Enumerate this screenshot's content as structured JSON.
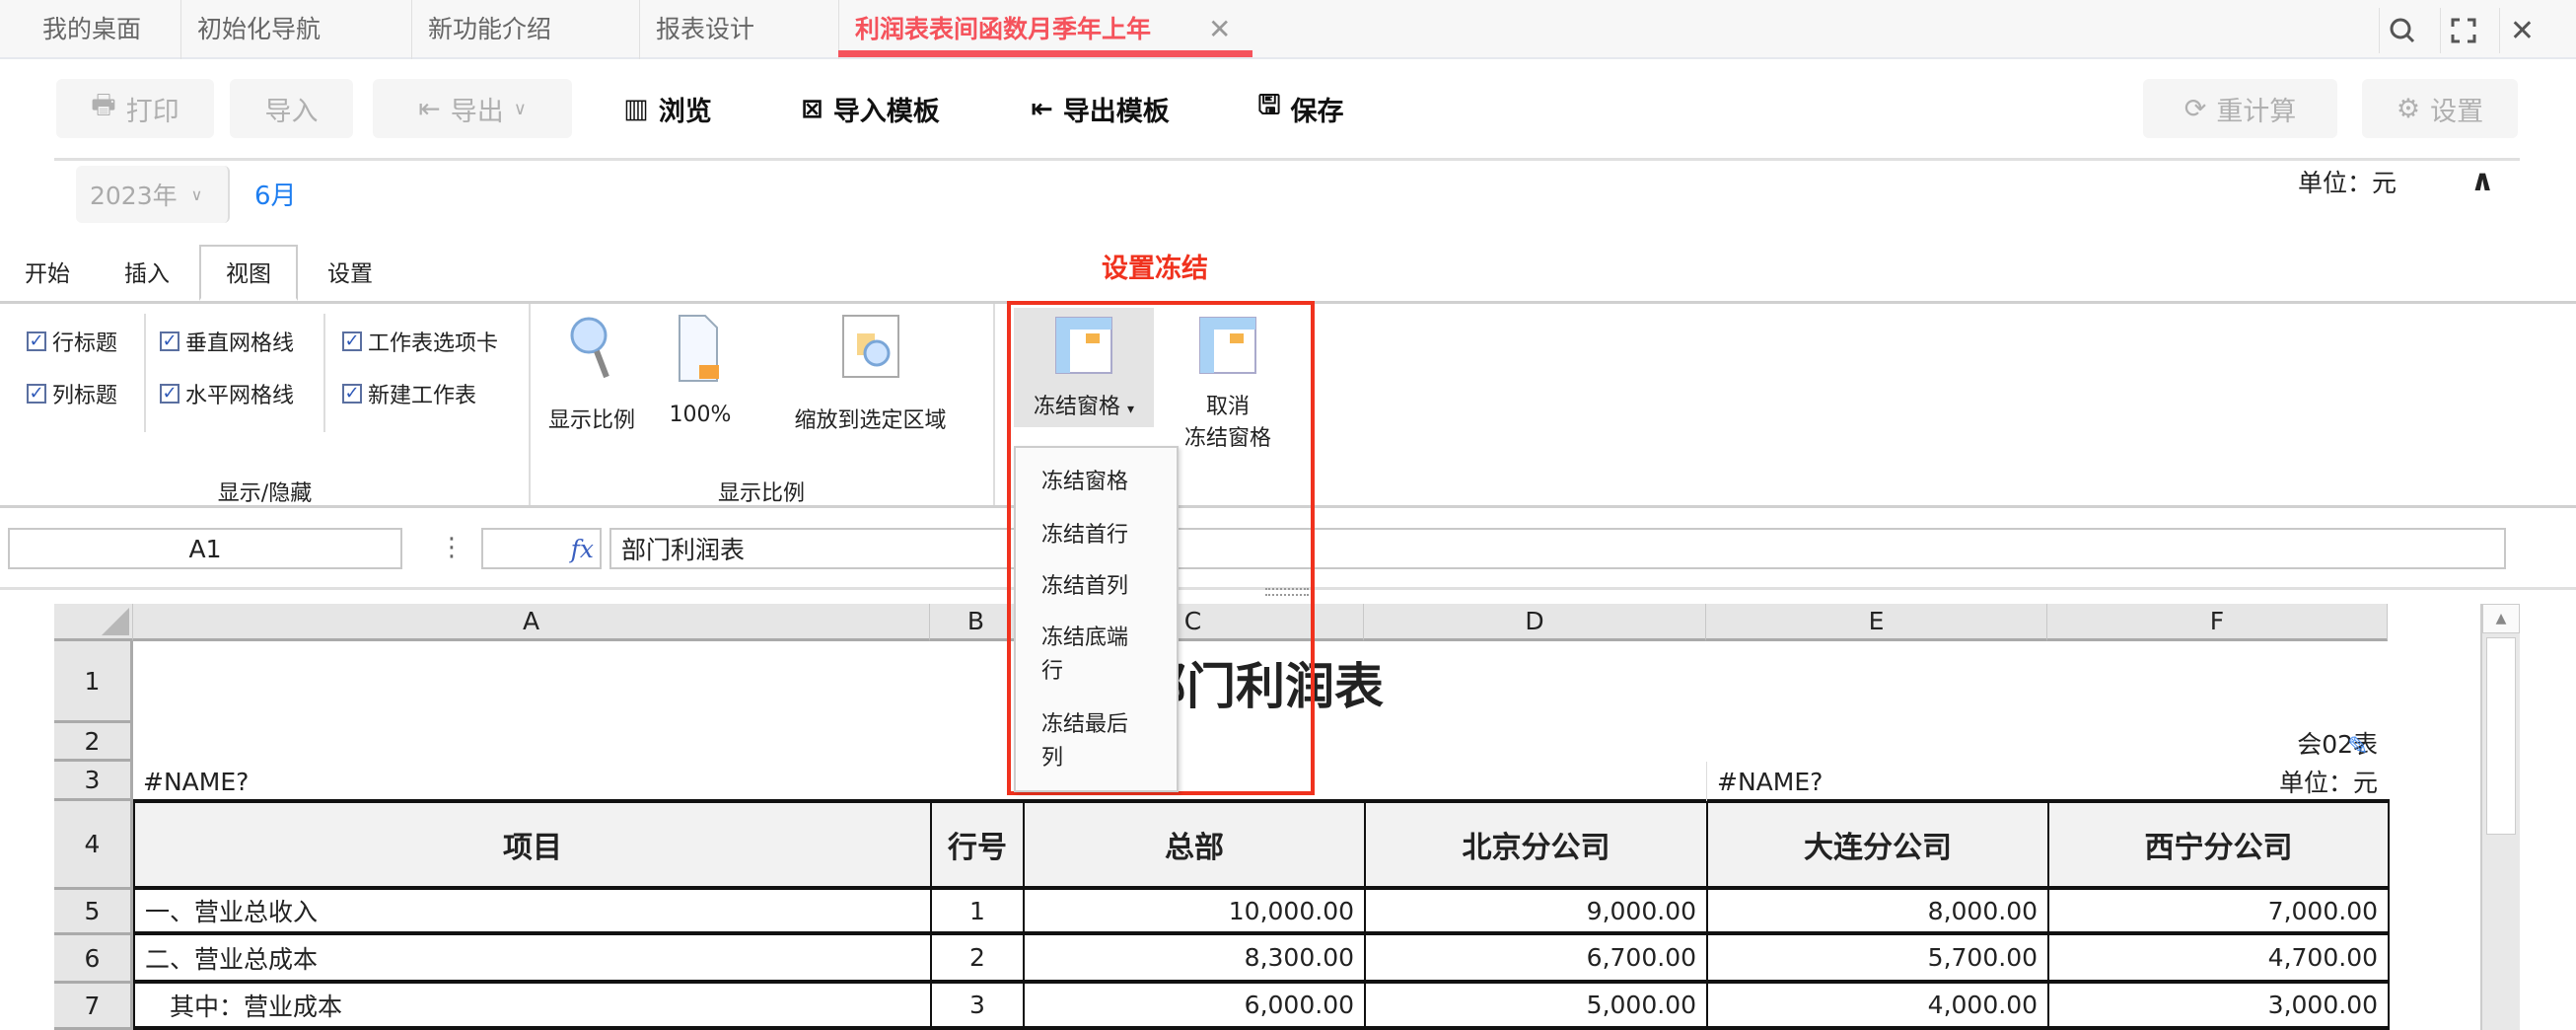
{
  "tabs": [
    {
      "label": "我的桌面"
    },
    {
      "label": "初始化导航"
    },
    {
      "label": "新功能介绍"
    },
    {
      "label": "报表设计"
    },
    {
      "label": "利润表表间函数月季年上年",
      "active": true
    }
  ],
  "window_icons": [
    "search-icon",
    "fullscreen-icon",
    "close-icon"
  ],
  "toolbar": {
    "print": "打印",
    "import": "导入",
    "export": "导出",
    "browse": "浏览",
    "import_template": "导入模板",
    "export_template": "导出模板",
    "save": "保存",
    "recalc": "重计算",
    "settings": "设置"
  },
  "filter": {
    "year": "2023年",
    "month": "6月",
    "unit": "单位：元"
  },
  "ribbon_tabs": [
    {
      "label": "开始"
    },
    {
      "label": "插入"
    },
    {
      "label": "视图",
      "active": true
    },
    {
      "label": "设置"
    }
  ],
  "annotation": "设置冻结",
  "show_hide": {
    "checks": [
      {
        "label": "行标题",
        "checked": true
      },
      {
        "label": "列标题",
        "checked": true
      },
      {
        "label": "垂直网格线",
        "checked": true
      },
      {
        "label": "水平网格线",
        "checked": true
      },
      {
        "label": "工作表选项卡",
        "checked": true
      },
      {
        "label": "新建工作表",
        "checked": true
      }
    ],
    "group_label": "显示/隐藏"
  },
  "zoom_group": {
    "zoom": "显示比例",
    "hundred": "100%",
    "fit": "缩放到选定区域",
    "group_label": "显示比例"
  },
  "freeze": {
    "freeze_panes": "冻结窗格",
    "unfreeze_line1": "取消",
    "unfreeze_line2": "冻结窗格",
    "menu": [
      "冻结窗格",
      "冻结首行",
      "冻结首列",
      "冻结底端行",
      "冻结最后列"
    ]
  },
  "formula_bar": {
    "cell_ref": "A1",
    "fx": "fx",
    "formula": "部门利润表"
  },
  "sheet": {
    "columns": [
      "A",
      "B",
      "C",
      "D",
      "E",
      "F"
    ],
    "rows": [
      "1",
      "2",
      "3",
      "4",
      "5",
      "6",
      "7"
    ],
    "title": "部门利润表",
    "form_no": "会02表",
    "name_err_a": "#NAME?",
    "name_err_e": "#NAME?",
    "unit": "单位：元",
    "headers": [
      "项目",
      "行号",
      "总部",
      "北京分公司",
      "大连分公司",
      "西宁分公司"
    ],
    "data": [
      [
        "一、营业总收入",
        "1",
        "10,000.00",
        "9,000.00",
        "8,000.00",
        "7,000.00"
      ],
      [
        "二、营业总成本",
        "2",
        "8,300.00",
        "6,700.00",
        "5,700.00",
        "4,700.00"
      ],
      [
        "　其中：营业成本",
        "3",
        "6,000.00",
        "5,000.00",
        "4,000.00",
        "3,000.00"
      ]
    ]
  },
  "colors": {
    "accent": "#f5535c",
    "annotation": "#f0321e",
    "link": "#1e7ef0"
  }
}
